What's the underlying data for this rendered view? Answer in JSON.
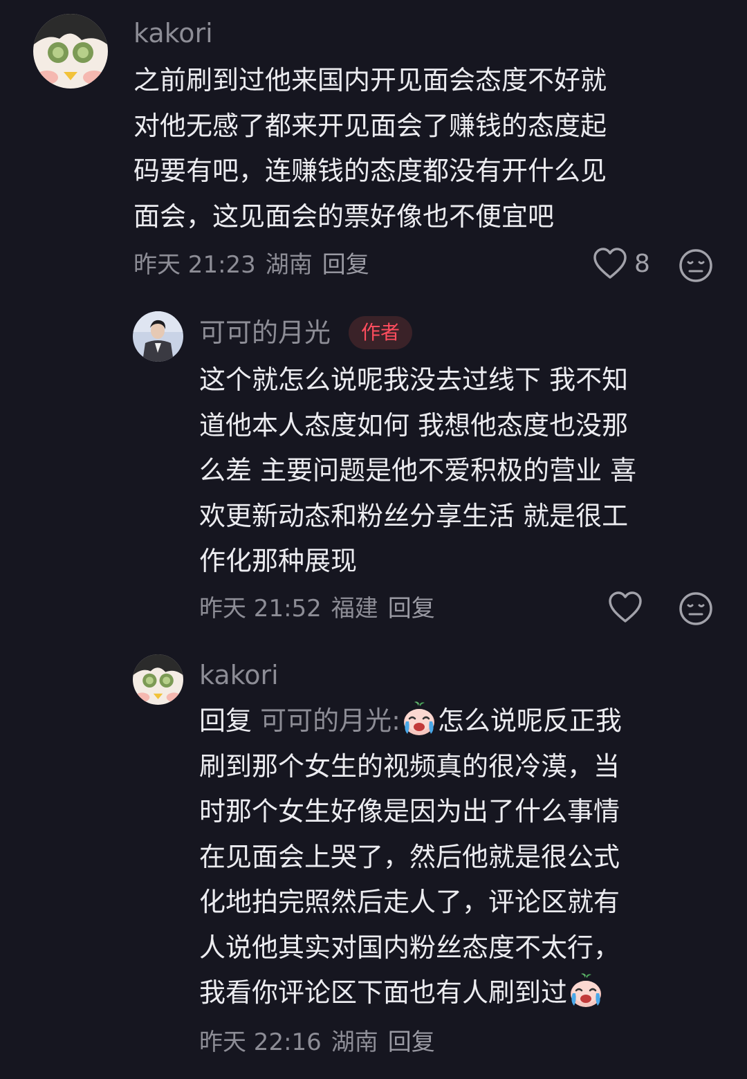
{
  "comments": [
    {
      "username": "kakori",
      "lines": [
        "之前刷到过他来国内开见面会态度不好就",
        "对他无感了都来开见面会了赚钱的态度起",
        "码要有吧，连赚钱的态度都没有开什么见",
        "面会，这见面会的票好像也不便宜吧"
      ],
      "time": "昨天 21:23",
      "location": "湖南",
      "reply_label": "回复",
      "like_count": "8",
      "like_icon": "heart-outline-icon",
      "dislike_icon": "meh-face-icon"
    },
    {
      "username": "可可的月光",
      "badge": "作者",
      "lines": [
        "这个就怎么说呢我没去过线下 我不知",
        "道他本人态度如何 我想他态度也没那",
        "么差 主要问题是他不爱积极的营业 喜",
        "欢更新动态和粉丝分享生活 就是很工",
        "作化那种展现"
      ],
      "time": "昨天 21:52",
      "location": "福建",
      "reply_label": "回复",
      "like_icon": "heart-outline-icon",
      "dislike_icon": "meh-face-icon"
    },
    {
      "username": "kakori",
      "reply_prefix": "回复",
      "reply_target": "可可的月光:",
      "first_line_rest": "怎么说呢反正我",
      "lines": [
        "刷到那个女生的视频真的很冷漠，当",
        "时那个女生好像是因为出了什么事情",
        "在见面会上哭了，然后他就是很公式",
        "化地拍完照然后走人了，评论区就有",
        "人说他其实对国内粉丝态度不太行，"
      ],
      "last_line": "我看你评论区下面也有人刷到过",
      "emoji_icon": "crying-face-emoji-icon",
      "time": "昨天 22:16",
      "location": "湖南",
      "reply_label": "回复"
    }
  ],
  "colors": {
    "background": "#161620",
    "text": "#ececf0",
    "muted": "#8d8d96",
    "badge_text": "#ff4d5e",
    "badge_bg": "#3a2228"
  }
}
